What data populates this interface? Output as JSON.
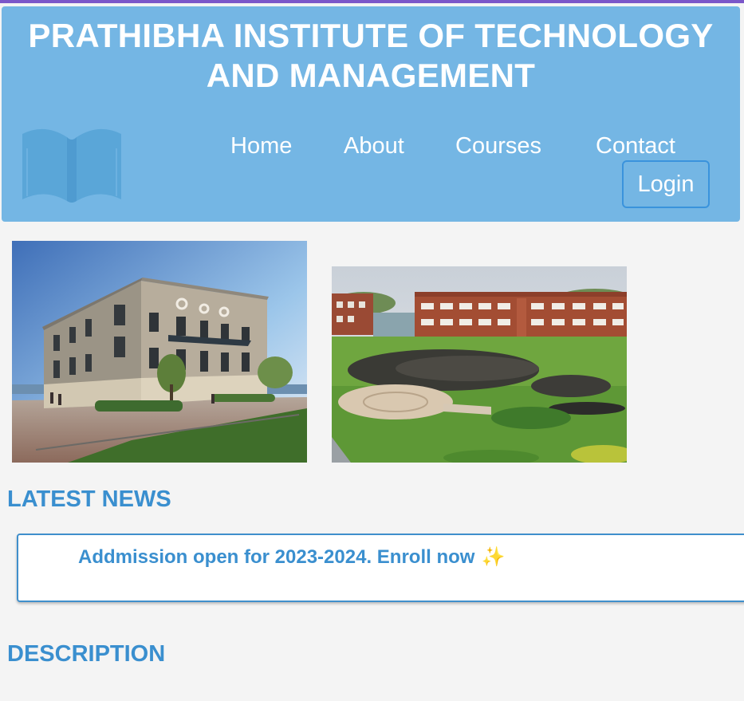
{
  "header": {
    "title_line1": "PRATHIBHA INSTITUTE OF TECHNOLOGY",
    "title_line2": "AND MANAGEMENT"
  },
  "nav": {
    "logo_icon": "open-book-icon",
    "items": [
      {
        "label": "Home"
      },
      {
        "label": "About"
      },
      {
        "label": "Courses"
      },
      {
        "label": "Contact"
      }
    ],
    "login_label": "Login"
  },
  "gallery": {
    "images": [
      {
        "name": "campus-building-photo"
      },
      {
        "name": "campus-quad-ceremony-photo"
      }
    ]
  },
  "news": {
    "heading": "LATEST NEWS",
    "items": [
      {
        "text": "Addmission open for 2023-2024. Enroll now",
        "emoji": "✨"
      }
    ]
  },
  "description": {
    "heading": "DESCRIPTION"
  },
  "colors": {
    "header_bg": "#74b6e4",
    "accent": "#3a8fcf",
    "page_bg": "#f4f4f4",
    "top_strip": "#7b57c9"
  }
}
